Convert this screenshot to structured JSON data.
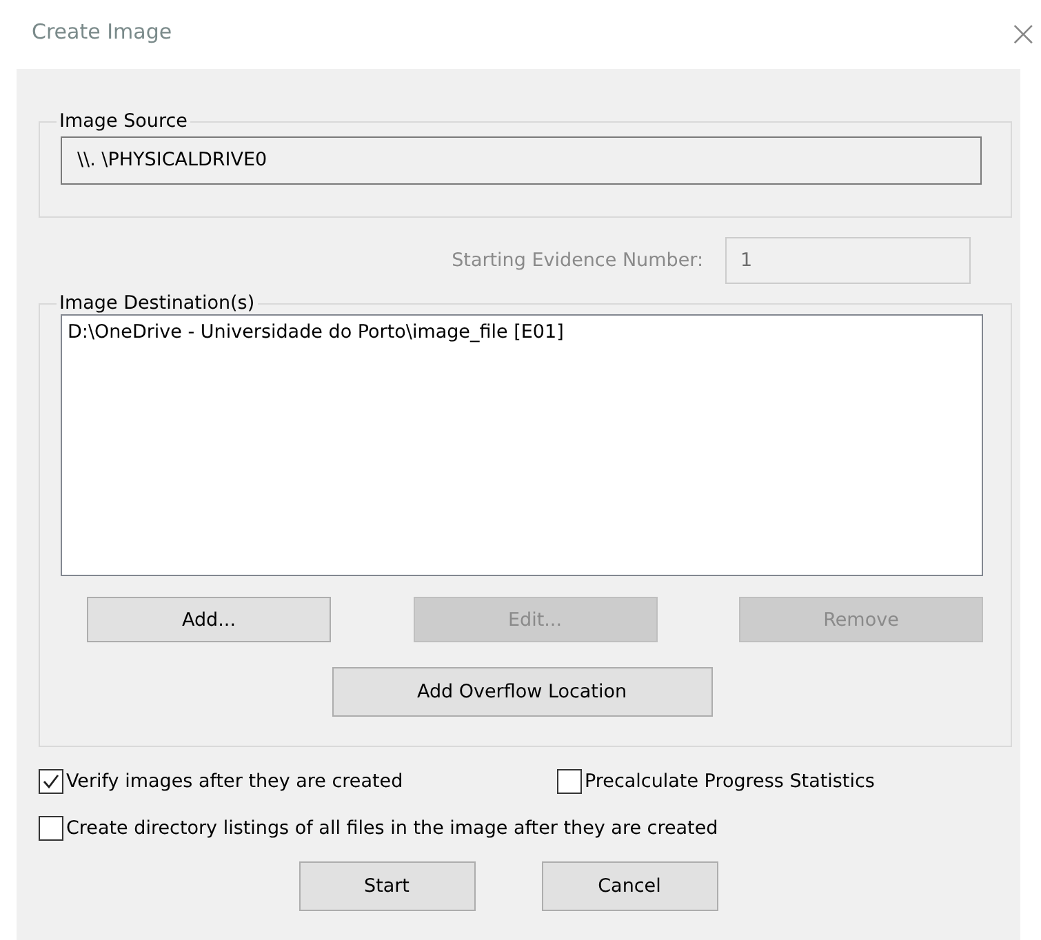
{
  "window": {
    "title": "Create Image",
    "close": "×"
  },
  "image_source": {
    "label": "Image Source",
    "value": "\\\\. \\PHYSICALDRIVE0"
  },
  "evidence_number": {
    "label": "Starting Evidence Number:",
    "value": "1",
    "disabled": true
  },
  "destinations": {
    "label": "Image Destination(s)",
    "items": [
      "D:\\OneDrive - Universidade do Porto\\image_file [E01]"
    ],
    "buttons": [
      {
        "label": "Add...",
        "disabled": false
      },
      {
        "label": "Edit...",
        "disabled": true
      },
      {
        "label": "Remove",
        "disabled": true
      }
    ],
    "overflow_button": {
      "label": "Add Overflow Location",
      "disabled": false
    }
  },
  "options": [
    {
      "label": "Verify images after they are created",
      "checked": true
    },
    {
      "label": "Precalculate Progress Statistics",
      "checked": false
    },
    {
      "label": "Create directory listings of all files in the image after they are created",
      "checked": false
    }
  ],
  "buttons": [
    {
      "label": "Start"
    },
    {
      "label": "Cancel"
    }
  ]
}
